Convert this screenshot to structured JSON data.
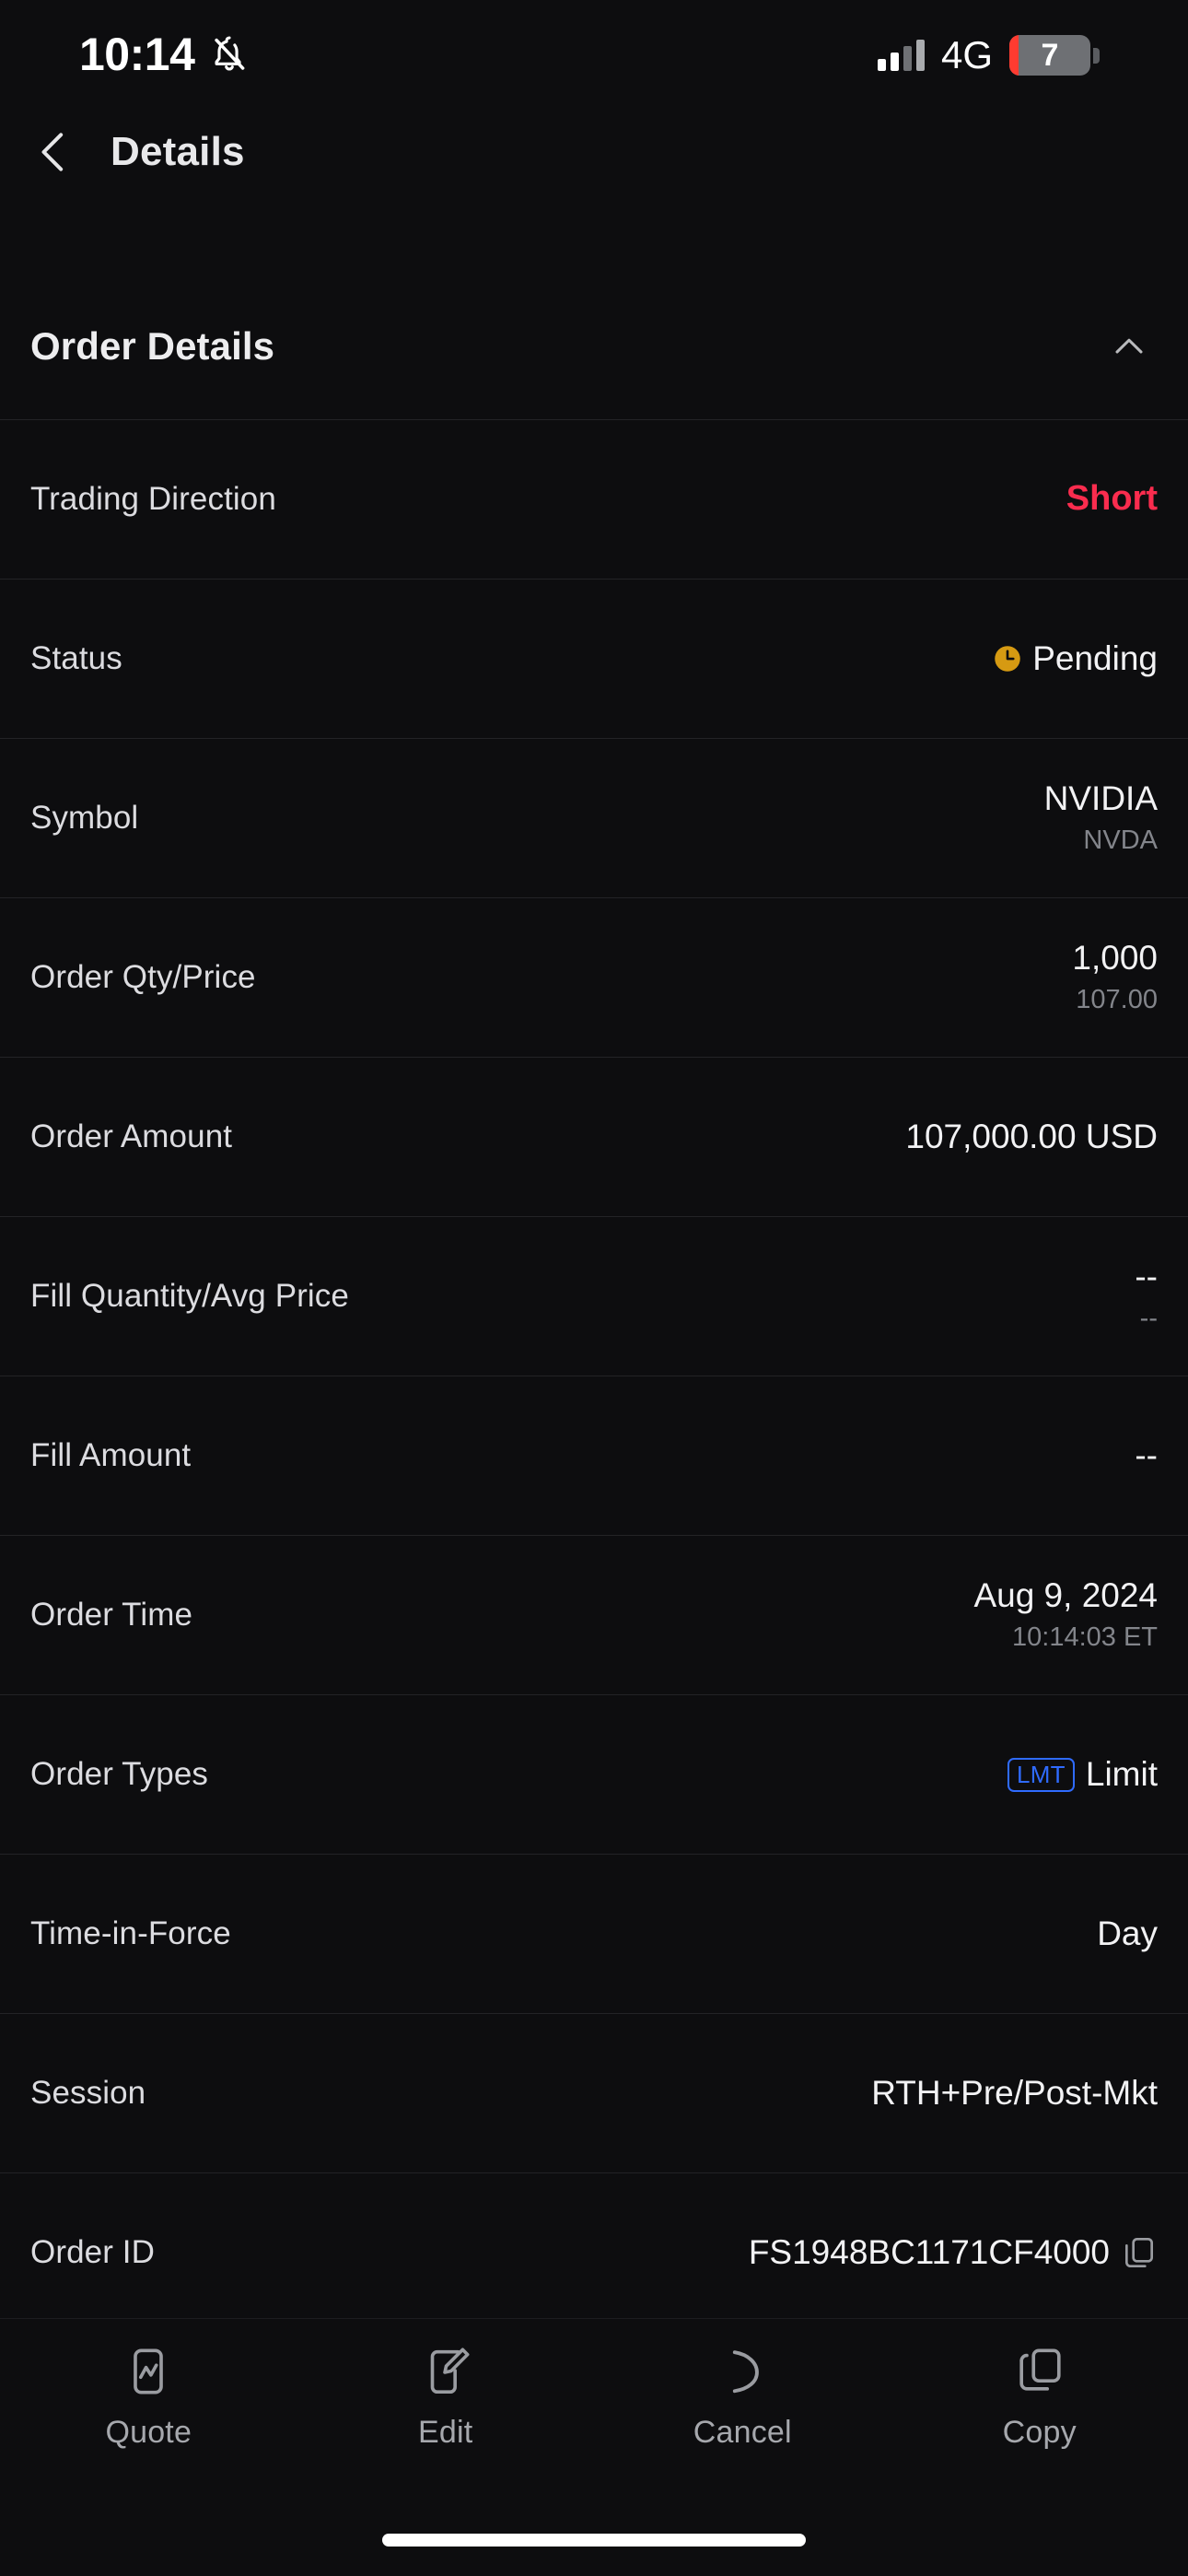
{
  "status_bar": {
    "time": "10:14",
    "silent_icon": "bell-slash-icon",
    "signal_icon": "cellular-signal-icon",
    "network": "4G",
    "battery_percent": "7",
    "battery_icon": "battery-low-icon",
    "low_battery_color": "#ff3b30"
  },
  "nav": {
    "back_icon": "chevron-left-icon",
    "title": "Details"
  },
  "section": {
    "title": "Order Details",
    "collapse_icon": "chevron-up-icon"
  },
  "colors": {
    "background": "#0d0d0f",
    "divider": "#232326",
    "primary_text": "#f2f2f4",
    "label_text": "#dcdce0",
    "secondary_text": "#83858b",
    "short_red": "#fa2c4e",
    "pending_amber": "#d69a12",
    "limit_blue": "#2f6bff"
  },
  "rows": [
    {
      "label": "Trading Direction",
      "value": "Short",
      "style": "negative"
    },
    {
      "label": "Status",
      "value": "Pending",
      "icon": "clock-icon"
    },
    {
      "label": "Symbol",
      "value": "NVIDIA",
      "subvalue": "NVDA"
    },
    {
      "label": "Order Qty/Price",
      "value": "1,000",
      "subvalue": "107.00"
    },
    {
      "label": "Order Amount",
      "value": "107,000.00 USD"
    },
    {
      "label": "Fill Quantity/Avg Price",
      "value": "--",
      "subvalue": "--"
    },
    {
      "label": "Fill Amount",
      "value": "--"
    },
    {
      "label": "Order Time",
      "value": "Aug 9, 2024",
      "subvalue": "10:14:03 ET"
    },
    {
      "label": "Order Types",
      "badge": "LMT",
      "value": "Limit"
    },
    {
      "label": "Time-in-Force",
      "value": "Day"
    },
    {
      "label": "Session",
      "value": "RTH+Pre/Post-Mkt"
    },
    {
      "label": "Order ID",
      "value": "FS1948BC1171CF4000",
      "icon": "copy-icon"
    }
  ],
  "toolbar": {
    "items": [
      {
        "label": "Quote",
        "icon": "quote-chart-icon"
      },
      {
        "label": "Edit",
        "icon": "edit-pencil-icon"
      },
      {
        "label": "Cancel",
        "icon": "cancel-undo-icon"
      },
      {
        "label": "Copy",
        "icon": "copy-duplicate-icon"
      }
    ]
  },
  "home_indicator": "home-indicator-bar"
}
